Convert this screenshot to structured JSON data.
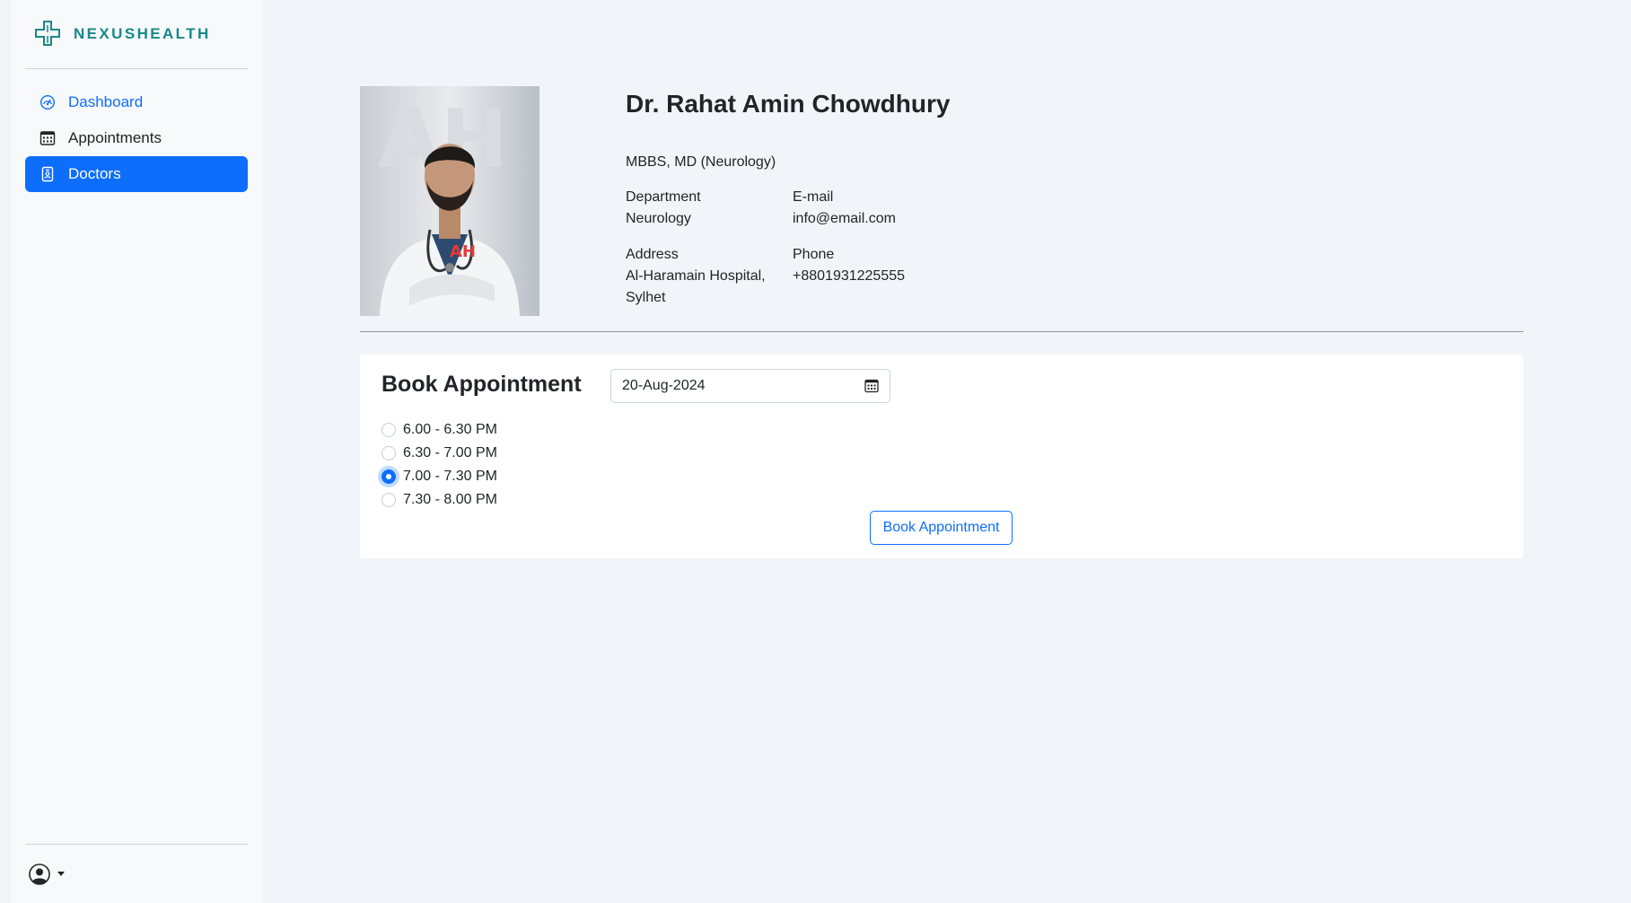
{
  "app": {
    "brand": "NEXUSHEALTH",
    "brand_color": "#17898a",
    "accent": "#0d6efd"
  },
  "sidebar": {
    "items": [
      {
        "label": "Dashboard",
        "icon": "speedometer-icon"
      },
      {
        "label": "Appointments",
        "icon": "calendar-grid-icon"
      },
      {
        "label": "Doctors",
        "icon": "person-badge-icon",
        "active": true
      }
    ]
  },
  "doctor": {
    "name": "Dr. Rahat Amin Chowdhury",
    "degree": "MBBS, MD (Neurology)",
    "department_label": "Department",
    "department": "Neurology",
    "email_label": "E-mail",
    "email": "info@email.com",
    "address_label": "Address",
    "address_line1": "Al-Haramain Hospital,",
    "address_line2": "Sylhet",
    "phone_label": "Phone",
    "phone": "+8801931225555",
    "photo_badge": "AH"
  },
  "booking": {
    "title": "Book Appointment",
    "date": "20-Aug-2024",
    "slots": [
      {
        "label": "6.00 - 6.30 PM",
        "selected": false
      },
      {
        "label": "6.30 - 7.00 PM",
        "selected": false
      },
      {
        "label": "7.00 - 7.30 PM",
        "selected": true
      },
      {
        "label": "7.30 - 8.00 PM",
        "selected": false
      }
    ],
    "button_label": "Book Appointment"
  }
}
